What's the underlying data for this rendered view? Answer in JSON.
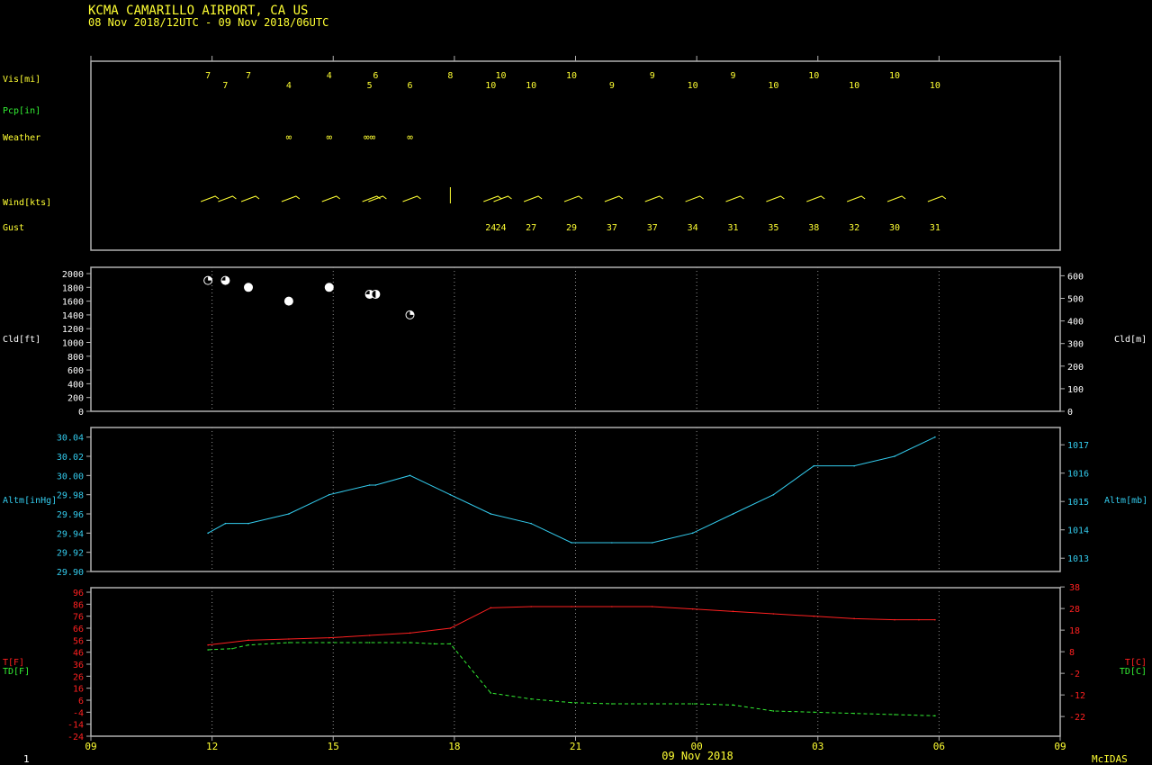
{
  "header": {
    "title": "KCMA  CAMARILLO AIRPORT, CA US",
    "subtitle": "08 Nov 2018/12UTC - 09 Nov 2018/06UTC"
  },
  "footer": {
    "date": "09 Nov 2018",
    "brand": "McIDAS",
    "page": "1"
  },
  "colors": {
    "yellow": "#ffff33",
    "green": "#33ee33",
    "cyan": "#33ccee",
    "red": "#ff2020",
    "white": "#ffffff",
    "frame": "#b0b0b0",
    "grid": "#909090"
  },
  "chart_data": {
    "type": "line",
    "time_axis": {
      "start_hour": 9,
      "end_hour": 33,
      "ticks": [
        {
          "h": 9,
          "label": "09"
        },
        {
          "h": 12,
          "label": "12"
        },
        {
          "h": 15,
          "label": "15"
        },
        {
          "h": 18,
          "label": "18"
        },
        {
          "h": 21,
          "label": "21"
        },
        {
          "h": 24,
          "label": "00"
        },
        {
          "h": 27,
          "label": "03"
        },
        {
          "h": 30,
          "label": "06"
        },
        {
          "h": 33,
          "label": "09"
        }
      ]
    },
    "labels": {
      "vis": "Vis[mi]",
      "pcp": "Pcp[in]",
      "weather": "Weather",
      "wind": "Wind[kts]",
      "gust": "Gust",
      "cld_left": "Cld[ft]",
      "cld_right": "Cld[m]",
      "altm_left": "Altm[inHg]",
      "altm_right": "Altm[mb]",
      "t_f": "T[F]",
      "td_f": "TD[F]",
      "t_c": "T[C]",
      "td_c": "TD[C]"
    },
    "visibility": [
      {
        "h": 11.9,
        "v": "7",
        "row": 0
      },
      {
        "h": 12.33,
        "v": "7",
        "row": 1
      },
      {
        "h": 12.9,
        "v": "7",
        "row": 0
      },
      {
        "h": 13.9,
        "v": "4",
        "row": 1
      },
      {
        "h": 14.9,
        "v": "4",
        "row": 0
      },
      {
        "h": 15.9,
        "v": "5",
        "row": 1
      },
      {
        "h": 16.05,
        "v": "6",
        "row": 0
      },
      {
        "h": 16.9,
        "v": "6",
        "row": 1
      },
      {
        "h": 17.9,
        "v": "8",
        "row": 0
      },
      {
        "h": 18.9,
        "v": "10",
        "row": 1
      },
      {
        "h": 19.15,
        "v": "10",
        "row": 0
      },
      {
        "h": 19.9,
        "v": "10",
        "row": 1
      },
      {
        "h": 20.9,
        "v": "10",
        "row": 0
      },
      {
        "h": 21.9,
        "v": "9",
        "row": 1
      },
      {
        "h": 22.9,
        "v": "9",
        "row": 0
      },
      {
        "h": 23.9,
        "v": "10",
        "row": 1
      },
      {
        "h": 24.9,
        "v": "9",
        "row": 0
      },
      {
        "h": 25.9,
        "v": "10",
        "row": 1
      },
      {
        "h": 26.9,
        "v": "10",
        "row": 0
      },
      {
        "h": 27.9,
        "v": "10",
        "row": 1
      },
      {
        "h": 28.9,
        "v": "10",
        "row": 0
      },
      {
        "h": 29.9,
        "v": "10",
        "row": 1
      }
    ],
    "weather": [
      {
        "h": 13.9,
        "v": "∞"
      },
      {
        "h": 14.9,
        "v": "∞"
      },
      {
        "h": 15.9,
        "v": "∞∞"
      },
      {
        "h": 16.9,
        "v": "∞"
      }
    ],
    "wind_barbs": [
      11.9,
      12.33,
      12.9,
      13.9,
      14.9,
      15.9,
      16.05,
      16.9,
      17.9,
      18.9,
      19.15,
      19.9,
      20.9,
      21.9,
      22.9,
      23.9,
      24.9,
      25.9,
      26.9,
      27.9,
      28.9,
      29.9
    ],
    "gusts": [
      {
        "h": 18.9,
        "v": "24"
      },
      {
        "h": 19.15,
        "v": "24"
      },
      {
        "h": 19.9,
        "v": "27"
      },
      {
        "h": 20.9,
        "v": "29"
      },
      {
        "h": 21.9,
        "v": "37"
      },
      {
        "h": 22.9,
        "v": "37"
      },
      {
        "h": 23.9,
        "v": "34"
      },
      {
        "h": 24.9,
        "v": "31"
      },
      {
        "h": 25.9,
        "v": "35"
      },
      {
        "h": 26.9,
        "v": "38"
      },
      {
        "h": 27.9,
        "v": "32"
      },
      {
        "h": 28.9,
        "v": "30"
      },
      {
        "h": 29.9,
        "v": "31"
      }
    ],
    "cloud": {
      "ylim_ft": [
        0,
        2000
      ],
      "left_ticks": [
        "0",
        "200",
        "400",
        "600",
        "800",
        "1000",
        "1200",
        "1400",
        "1600",
        "1800",
        "2000"
      ],
      "right_ticks": [
        "0",
        "100",
        "200",
        "300",
        "400",
        "500",
        "600"
      ],
      "points": [
        {
          "h": 11.9,
          "ft": 1900,
          "cover": "few"
        },
        {
          "h": 12.33,
          "ft": 1900,
          "cover": "bkn"
        },
        {
          "h": 12.9,
          "ft": 1800,
          "cover": "ovc"
        },
        {
          "h": 13.9,
          "ft": 1600,
          "cover": "ovc"
        },
        {
          "h": 14.9,
          "ft": 1800,
          "cover": "ovc"
        },
        {
          "h": 15.9,
          "ft": 1700,
          "cover": "bkn"
        },
        {
          "h": 16.05,
          "ft": 1700,
          "cover": "sct"
        },
        {
          "h": 16.9,
          "ft": 1400,
          "cover": "few"
        }
      ]
    },
    "altimeter": {
      "ylim": [
        29.9,
        30.05
      ],
      "left_ticks": [
        "29.90",
        "29.92",
        "29.94",
        "29.96",
        "29.98",
        "30.00",
        "30.02",
        "30.04"
      ],
      "right_ticks": [
        "1013",
        "1014",
        "1015",
        "1016",
        "1017"
      ],
      "x": [
        11.9,
        12.33,
        12.9,
        13.9,
        14.9,
        15.9,
        16.05,
        16.9,
        17.9,
        18.9,
        19.9,
        20.9,
        21.9,
        22.9,
        23.9,
        24.9,
        25.9,
        26.9,
        27.9,
        28.9,
        29.9
      ],
      "values": [
        29.94,
        29.95,
        29.95,
        29.96,
        29.98,
        29.99,
        29.99,
        30.0,
        29.98,
        29.96,
        29.95,
        29.93,
        29.93,
        29.93,
        29.94,
        29.96,
        29.98,
        30.01,
        30.01,
        30.02,
        30.04
      ]
    },
    "temperature": {
      "ylim_f": [
        -24,
        96
      ],
      "left_ticks": [
        "-24",
        "-14",
        "-4",
        "6",
        "16",
        "26",
        "36",
        "46",
        "56",
        "66",
        "76",
        "86",
        "96"
      ],
      "right_ticks": [
        "-22",
        "-12",
        "-2",
        "8",
        "18",
        "28",
        "38"
      ],
      "series": [
        {
          "name": "T[F]",
          "x": [
            11.9,
            12.9,
            13.9,
            14.9,
            15.9,
            16.9,
            17.9,
            18.9,
            19.9,
            20.9,
            21.9,
            22.9,
            23.9,
            24.9,
            25.9,
            26.9,
            27.9,
            28.9,
            29.5,
            29.9
          ],
          "values": [
            52,
            56,
            57,
            58,
            60,
            62,
            66,
            83,
            84,
            84,
            84,
            84,
            82,
            80,
            78,
            76,
            74,
            73,
            73,
            73
          ]
        },
        {
          "name": "TD[F]",
          "x": [
            11.9,
            12.5,
            12.9,
            13.9,
            14.9,
            15.9,
            16.9,
            17.5,
            17.9,
            18.9,
            19.9,
            20.9,
            21.9,
            22.9,
            23.9,
            24.9,
            25.9,
            26.9,
            27.9,
            28.9,
            29.9
          ],
          "values": [
            48,
            49,
            52,
            54,
            54,
            54,
            54,
            53,
            53,
            12,
            7,
            4,
            3,
            3,
            3,
            2,
            -3,
            -4,
            -5,
            -6,
            -7
          ]
        }
      ]
    }
  }
}
